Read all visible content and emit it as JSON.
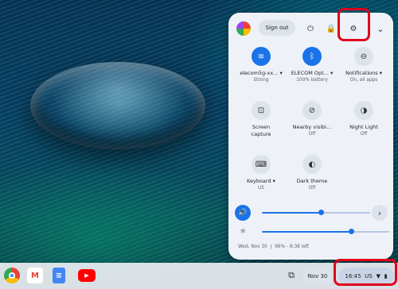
{
  "quick_settings": {
    "sign_out": "Sign out",
    "tiles": [
      {
        "name": "elecom5g-xx...",
        "sub": "Strong",
        "icon": "wifi-icon",
        "glyph": "📶",
        "on": true,
        "dropdown": true
      },
      {
        "name": "ELECOM Opt...",
        "sub": "100% battery",
        "icon": "bluetooth-icon",
        "glyph": "ᛒ",
        "on": true,
        "dropdown": true
      },
      {
        "name": "Notifications",
        "sub": "On, all apps",
        "icon": "notifications-icon",
        "glyph": "⊖",
        "on": false,
        "dropdown": true
      },
      {
        "name": "Screen",
        "name2": "capture",
        "sub": "",
        "icon": "screen-capture-icon",
        "glyph": "⊡",
        "on": false,
        "dropdown": false
      },
      {
        "name": "Nearby visibi...",
        "sub": "Off",
        "icon": "nearby-share-icon",
        "glyph": "⊘",
        "on": false,
        "dropdown": false
      },
      {
        "name": "Night Light",
        "sub": "Off",
        "icon": "night-light-icon",
        "glyph": "◑",
        "on": false,
        "dropdown": false
      },
      {
        "name": "Keyboard",
        "sub": "US",
        "icon": "keyboard-icon",
        "glyph": "⌨",
        "on": false,
        "dropdown": true
      },
      {
        "name": "Dark theme",
        "sub": "Off",
        "icon": "dark-theme-icon",
        "glyph": "◐",
        "on": false,
        "dropdown": false
      }
    ],
    "volume_level": 0.55,
    "brightness_level": 0.7,
    "footer_date": "Wed, Nov 30",
    "footer_battery": "96% - 8:38 left"
  },
  "shelf": {
    "apps": [
      "Chrome",
      "Gmail",
      "Docs",
      "YouTube"
    ],
    "date": "Nov 30",
    "time": "16:45",
    "ime": "US"
  },
  "colors": {
    "accent": "#1a73e8",
    "highlight": "#e0001b"
  }
}
